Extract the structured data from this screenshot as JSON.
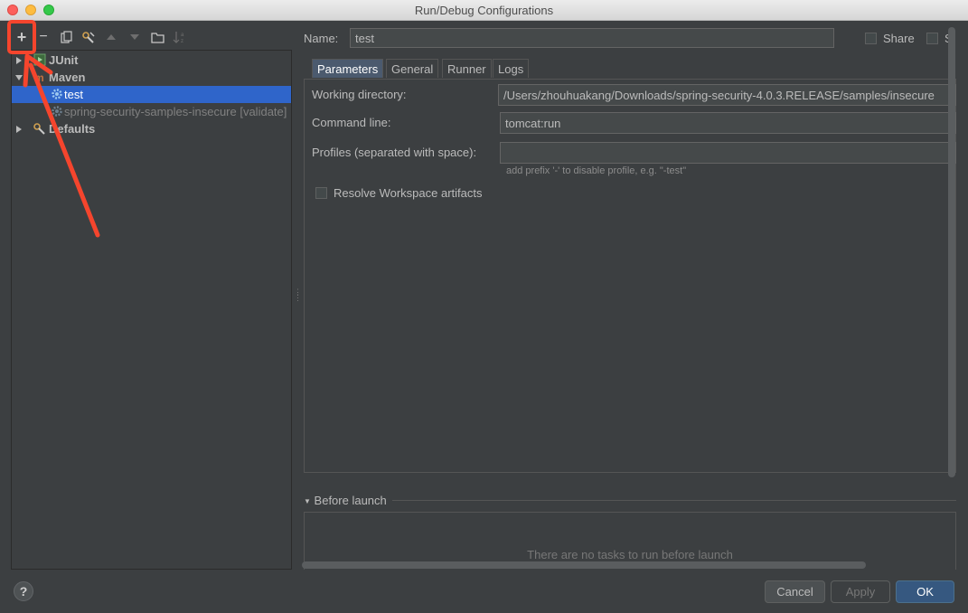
{
  "window": {
    "title": "Run/Debug Configurations"
  },
  "toolbar": {
    "add": "+",
    "remove": "−",
    "icons": [
      "add-icon",
      "remove-icon",
      "copy-icon",
      "edit-defaults-icon",
      "move-up-icon",
      "move-down-icon",
      "folder-icon",
      "sort-icon"
    ]
  },
  "tree": {
    "nodes": [
      {
        "label": "JUnit",
        "icon": "junit-icon",
        "expanded": false
      },
      {
        "label": "Maven",
        "icon": "maven-icon",
        "expanded": true
      },
      {
        "label": "test",
        "icon": "gear-icon",
        "selected": true
      },
      {
        "label": "spring-security-samples-insecure [validate]",
        "icon": "gear-icon",
        "disabled": true
      },
      {
        "label": "Defaults",
        "icon": "defaults-icon",
        "expanded": false
      }
    ]
  },
  "config": {
    "name_label": "Name:",
    "name_value": "test",
    "share_label": "Share",
    "single_label": "Si"
  },
  "tabs": [
    "Parameters",
    "General",
    "Runner",
    "Logs"
  ],
  "parameters": {
    "working_dir_label": "Working directory:",
    "working_dir_value": "/Users/zhouhuakang/Downloads/spring-security-4.0.3.RELEASE/samples/insecure",
    "command_line_label": "Command line:",
    "command_line_value": "tomcat:run",
    "profiles_label": "Profiles (separated with space):",
    "profiles_value": "",
    "profiles_hint": "add prefix '-' to disable profile, e.g. \"-test\"",
    "resolve_label": "Resolve Workspace artifacts"
  },
  "before_launch": {
    "header": "Before launch",
    "empty_text": "There are no tasks to run before launch"
  },
  "buttons": {
    "help": "?",
    "cancel": "Cancel",
    "apply": "Apply",
    "ok": "OK"
  },
  "colors": {
    "selection": "#2f65ca",
    "annotation": "#f5452d",
    "ok_button": "#365880"
  }
}
